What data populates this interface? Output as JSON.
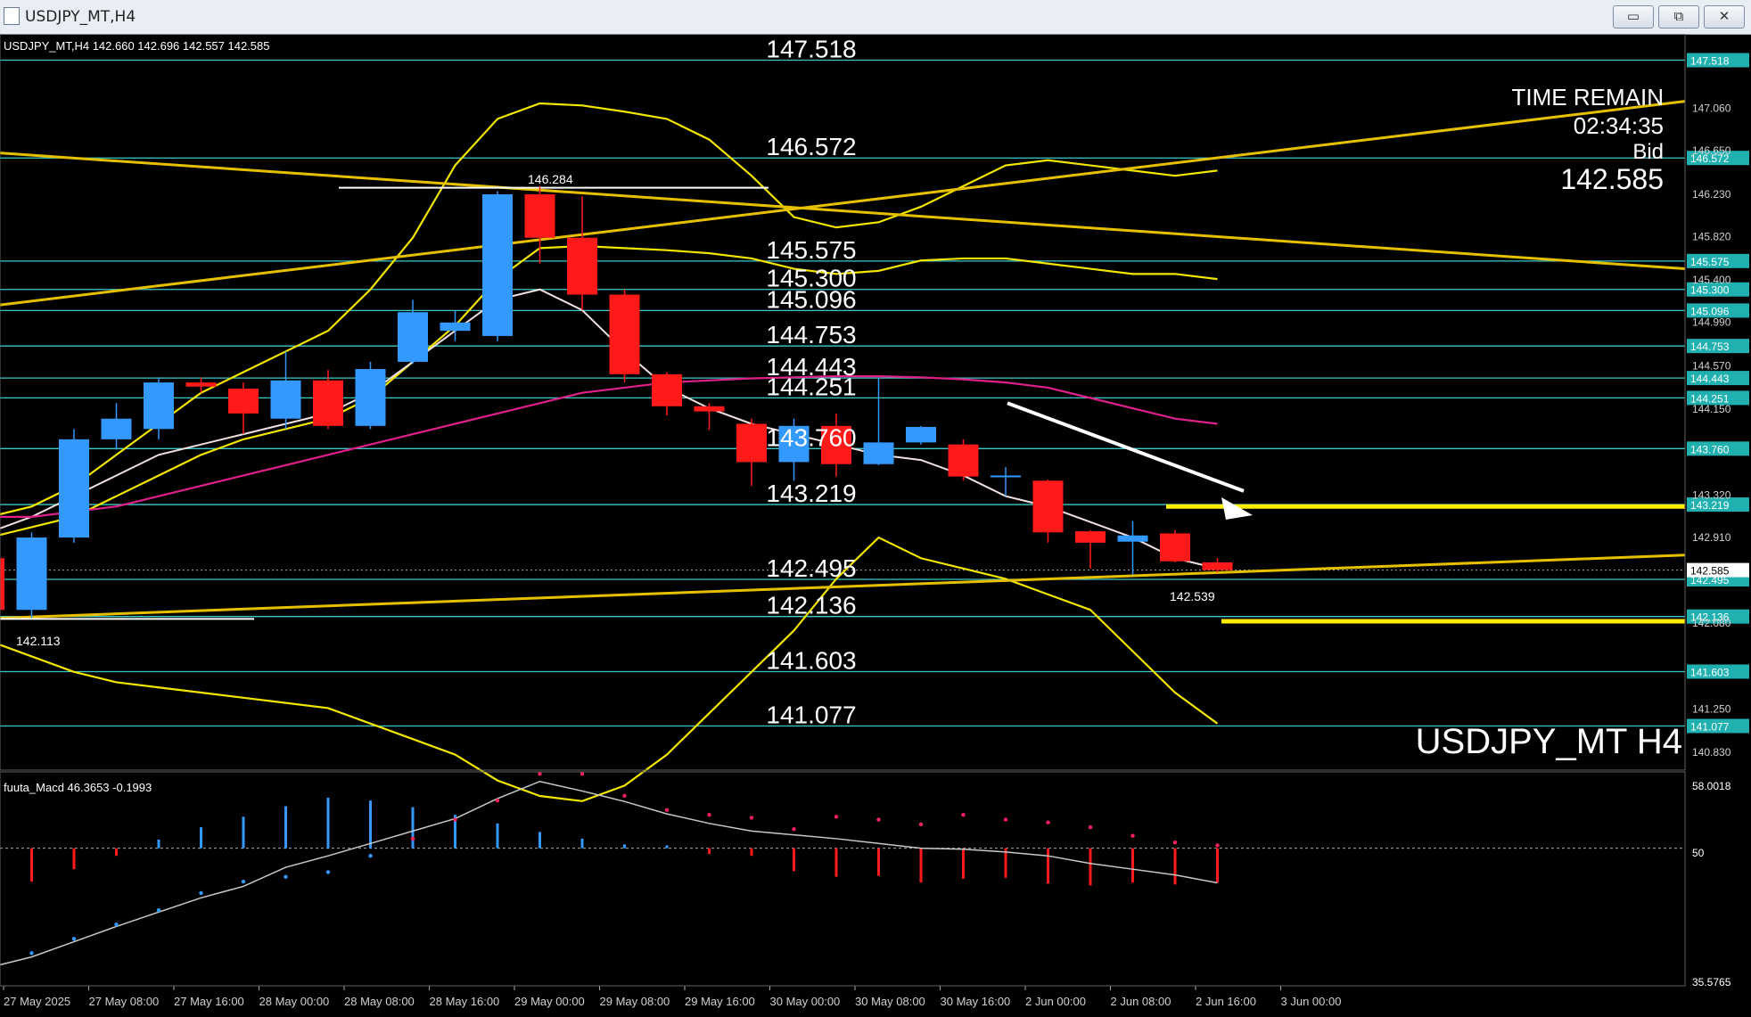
{
  "window": {
    "title": "USDJPY_MT,H4",
    "buttons": {
      "minimize": "▭",
      "restore": "⧉",
      "close": "✕"
    }
  },
  "chart_header": {
    "symbol_info": "USDJPY_MT,H4 142.660 142.696 142.557 142.585"
  },
  "symbol_label": "USDJPY_MT H4",
  "time_remain": {
    "label": "TIME REMAIN",
    "value": "02:34:35",
    "bid_label": "Bid",
    "bid_value": "142.585"
  },
  "price_axis_labels": [
    "147.060",
    "146.650",
    "146.230",
    "145.820",
    "145.400",
    "144.990",
    "144.570",
    "144.150",
    "143.320",
    "142.910",
    "142.080",
    "141.250",
    "140.830"
  ],
  "levels": [
    "147.518",
    "146.572",
    "145.575",
    "145.300",
    "145.096",
    "144.753",
    "144.443",
    "144.251",
    "143.760",
    "143.219",
    "142.495",
    "142.136",
    "141.603",
    "141.077"
  ],
  "current_price": "142.585",
  "annotations": {
    "high": "146.284",
    "low_left": "142.113",
    "low_right": "142.539"
  },
  "time_axis": [
    "27 May 2025",
    "27 May 08:00",
    "27 May 16:00",
    "28 May 00:00",
    "28 May 08:00",
    "28 May 16:00",
    "29 May 00:00",
    "29 May 08:00",
    "29 May 16:00",
    "30 May 00:00",
    "30 May 08:00",
    "30 May 16:00",
    "2 Jun 00:00",
    "2 Jun 08:00",
    "2 Jun 16:00",
    "3 Jun 00:00"
  ],
  "macd_panel": {
    "label": "fuuta_Macd 46.3653 -0.1993",
    "axis_top": "58.0018",
    "axis_mid": "50",
    "axis_bottom": "35.5765"
  },
  "colors": {
    "bull": "#3399ff",
    "bear": "#ff1a1a",
    "level_line": "#40c8c8",
    "band": "#f2e600",
    "trend": "#e6c000",
    "ma_white": "#f0e0e0",
    "ma_magenta": "#e0208a"
  },
  "chart_data": {
    "type": "candlestick",
    "title": "USDJPY_MT,H4",
    "candles": [
      {
        "o": 142.7,
        "h": 142.75,
        "l": 142.15,
        "c": 142.2
      },
      {
        "o": 142.2,
        "h": 142.95,
        "l": 142.12,
        "c": 142.9
      },
      {
        "o": 142.9,
        "h": 143.95,
        "l": 142.85,
        "c": 143.85
      },
      {
        "o": 143.85,
        "h": 144.2,
        "l": 143.75,
        "c": 144.05
      },
      {
        "o": 143.95,
        "h": 144.45,
        "l": 143.85,
        "c": 144.4
      },
      {
        "o": 144.4,
        "h": 144.45,
        "l": 144.3,
        "c": 144.36
      },
      {
        "o": 144.34,
        "h": 144.4,
        "l": 143.9,
        "c": 144.1
      },
      {
        "o": 144.05,
        "h": 144.7,
        "l": 143.95,
        "c": 144.42
      },
      {
        "o": 144.42,
        "h": 144.52,
        "l": 143.95,
        "c": 143.98
      },
      {
        "o": 143.98,
        "h": 144.6,
        "l": 143.95,
        "c": 144.53
      },
      {
        "o": 144.6,
        "h": 145.2,
        "l": 144.58,
        "c": 145.08
      },
      {
        "o": 144.9,
        "h": 145.1,
        "l": 144.8,
        "c": 144.98
      },
      {
        "o": 144.85,
        "h": 146.25,
        "l": 144.8,
        "c": 146.22
      },
      {
        "o": 146.22,
        "h": 146.3,
        "l": 145.55,
        "c": 145.8
      },
      {
        "o": 145.8,
        "h": 146.2,
        "l": 145.1,
        "c": 145.25
      },
      {
        "o": 145.25,
        "h": 145.3,
        "l": 144.4,
        "c": 144.48
      },
      {
        "o": 144.48,
        "h": 144.5,
        "l": 144.08,
        "c": 144.17
      },
      {
        "o": 144.17,
        "h": 144.2,
        "l": 143.94,
        "c": 144.12
      },
      {
        "o": 144.0,
        "h": 144.05,
        "l": 143.4,
        "c": 143.63
      },
      {
        "o": 143.63,
        "h": 144.05,
        "l": 143.45,
        "c": 143.98
      },
      {
        "o": 143.98,
        "h": 144.1,
        "l": 143.49,
        "c": 143.61
      },
      {
        "o": 143.61,
        "h": 144.44,
        "l": 143.6,
        "c": 143.82
      },
      {
        "o": 143.82,
        "h": 143.98,
        "l": 143.8,
        "c": 143.97
      },
      {
        "o": 143.8,
        "h": 143.85,
        "l": 143.45,
        "c": 143.49
      },
      {
        "o": 143.5,
        "h": 143.58,
        "l": 143.3,
        "c": 143.5
      },
      {
        "o": 143.45,
        "h": 143.46,
        "l": 142.85,
        "c": 142.95
      },
      {
        "o": 142.96,
        "h": 142.97,
        "l": 142.6,
        "c": 142.85
      },
      {
        "o": 142.86,
        "h": 143.06,
        "l": 142.54,
        "c": 142.92
      },
      {
        "o": 142.94,
        "h": 142.97,
        "l": 142.66,
        "c": 142.67
      },
      {
        "o": 142.66,
        "h": 142.7,
        "l": 142.56,
        "c": 142.585
      }
    ],
    "macd_histogram": [
      44.8,
      46.5,
      47.8,
      49.2,
      50.9,
      52.2,
      53.3,
      54.4,
      55.3,
      55.0,
      54.3,
      53.5,
      52.6,
      51.7,
      51.0,
      50.4,
      50.3,
      49.4,
      49.2,
      47.6,
      47.0,
      47.1,
      46.4,
      46.8,
      46.9,
      46.3,
      46.1,
      46.4,
      46.2,
      46.4
    ],
    "macd_line": [
      37.5,
      38.6,
      40.2,
      41.8,
      43.3,
      44.8,
      46.0,
      48.0,
      49.2,
      50.5,
      51.8,
      53.1,
      55.2,
      57.0,
      56.0,
      54.9,
      53.6,
      52.6,
      51.8,
      51.4,
      51.0,
      50.5,
      50.0,
      49.9,
      49.6,
      49.2,
      48.4,
      47.8,
      47.2,
      46.37
    ],
    "macd_signal": [
      37.0,
      39.0,
      40.5,
      42.0,
      43.5,
      45.3,
      46.5,
      47.0,
      47.5,
      49.2,
      51.0,
      53.0,
      55.0,
      57.8,
      57.8,
      55.5,
      54.0,
      53.5,
      53.2,
      52.0,
      53.3,
      53.0,
      52.5,
      53.5,
      53.0,
      52.7,
      52.2,
      51.3,
      50.6,
      50.3
    ],
    "ylim": [
      140.65,
      147.6
    ],
    "macd_ylim": [
      35.5765,
      58.0018
    ]
  }
}
